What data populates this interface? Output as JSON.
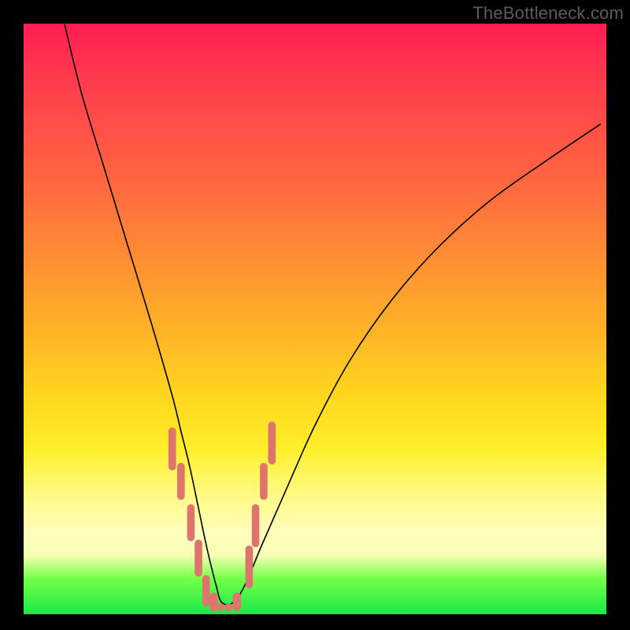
{
  "watermark": "TheBottleneck.com",
  "chart_data": {
    "type": "line",
    "title": "",
    "xlabel": "",
    "ylabel": "",
    "xlim": [
      0,
      100
    ],
    "ylim": [
      0,
      100
    ],
    "grid": false,
    "legend": false,
    "series": [
      {
        "name": "bottleneck-curve",
        "x": [
          7,
          10,
          14,
          18,
          22,
          25.5,
          27,
          28.5,
          30,
          31.5,
          33,
          34,
          36,
          38,
          41,
          45,
          50,
          56,
          63,
          71,
          80,
          90,
          99
        ],
        "values": [
          100,
          88,
          75,
          62,
          49,
          37,
          31,
          25,
          18,
          11,
          5,
          2,
          2,
          5,
          12,
          21,
          32,
          43,
          53,
          62,
          70,
          77,
          83
        ],
        "stroke": "#000000",
        "stroke_width": 1.6
      },
      {
        "name": "highlight-dashes",
        "description": "Salmon tick marks near the valley floor over the pale band",
        "color": "#df746d",
        "segments": [
          {
            "x": 25.5,
            "y1": 31,
            "y2": 25,
            "w": 3.2
          },
          {
            "x": 27.0,
            "y1": 25,
            "y2": 20,
            "w": 3.2
          },
          {
            "x": 28.7,
            "y1": 18,
            "y2": 13,
            "w": 3.2
          },
          {
            "x": 30.0,
            "y1": 12,
            "y2": 7,
            "w": 3.2
          },
          {
            "x": 31.3,
            "y1": 6,
            "y2": 2,
            "w": 3.2
          },
          {
            "x": 32.6,
            "y1": 3,
            "y2": 1.2,
            "w": 3.4
          },
          {
            "x": 33.8,
            "y1": 1.2,
            "y2": 1.2,
            "w": 3.4
          },
          {
            "x": 35.2,
            "y1": 1.2,
            "y2": 1.2,
            "w": 3.4
          },
          {
            "x": 36.6,
            "y1": 1.2,
            "y2": 3,
            "w": 3.4
          },
          {
            "x": 38.7,
            "y1": 5,
            "y2": 11,
            "w": 3.2
          },
          {
            "x": 39.8,
            "y1": 12,
            "y2": 18,
            "w": 3.2
          },
          {
            "x": 41.2,
            "y1": 20,
            "y2": 25,
            "w": 3.2
          },
          {
            "x": 42.6,
            "y1": 26,
            "y2": 32,
            "w": 3.2
          }
        ]
      }
    ]
  }
}
